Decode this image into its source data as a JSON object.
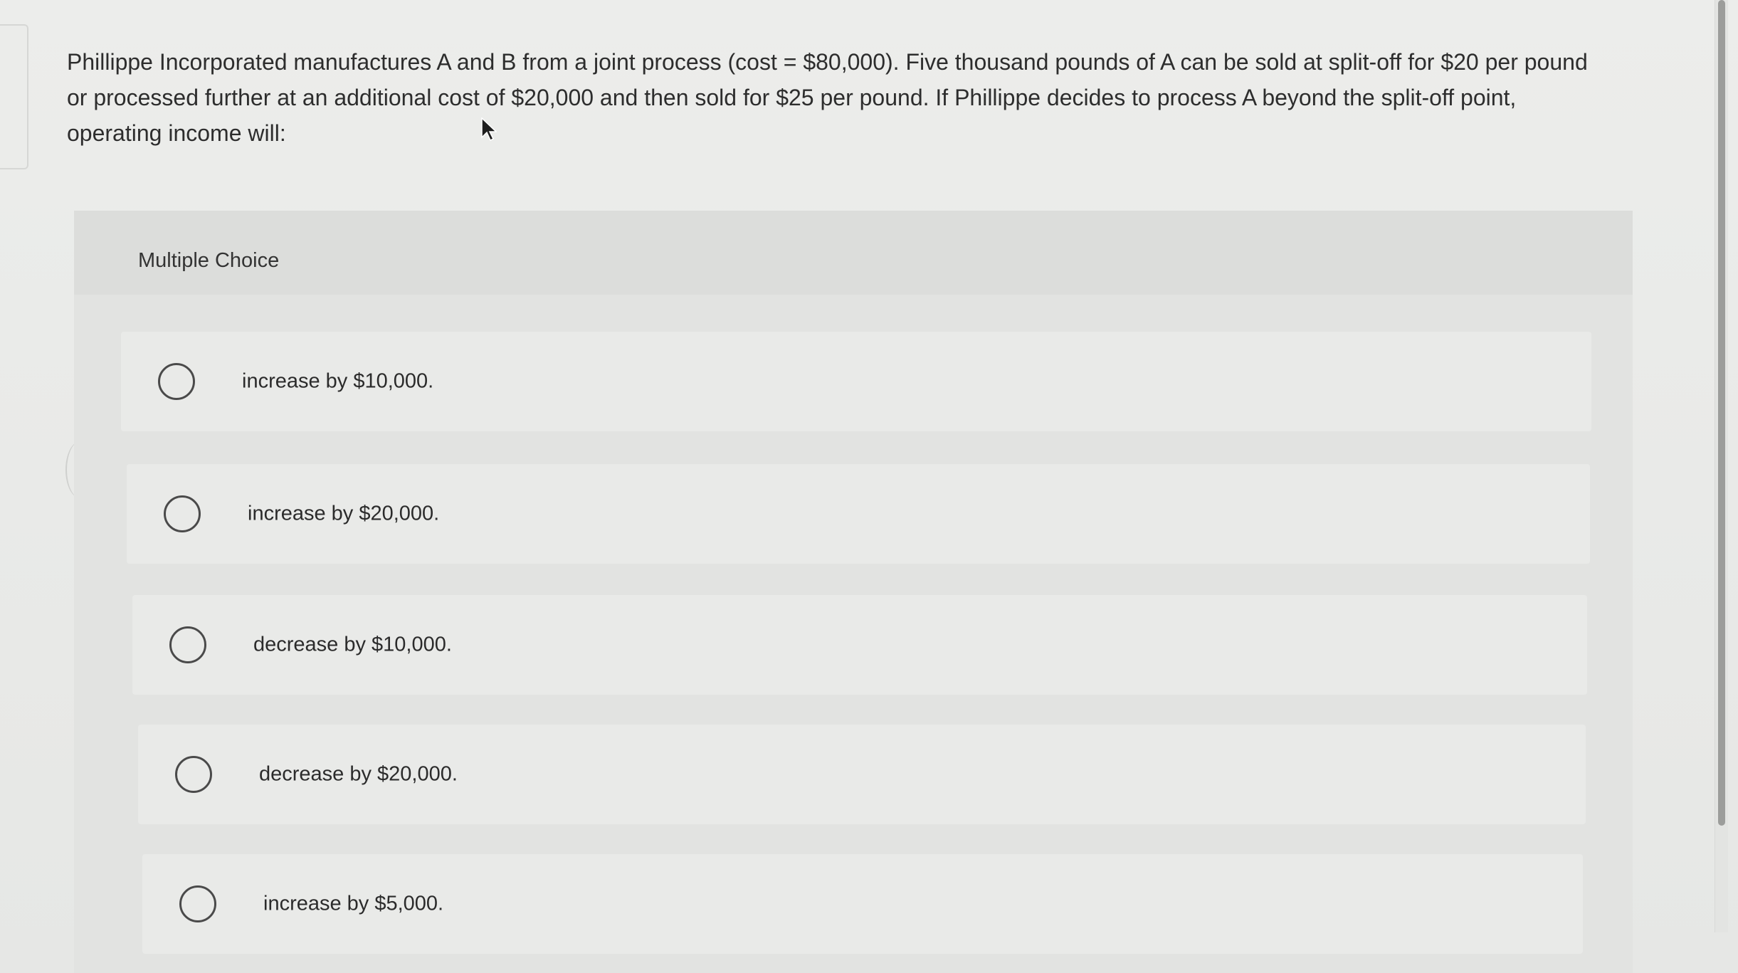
{
  "question": {
    "text": "Phillippe Incorporated manufactures A and B from a joint process (cost = $80,000). Five thousand pounds of A can be sold at split-off for $20 per pound or processed further at an additional cost of $20,000 and then sold for $25 per pound. If Phillippe decides to process A beyond the split-off point, operating income will:"
  },
  "multiple_choice": {
    "label": "Multiple Choice",
    "options": [
      {
        "label": "increase by $10,000."
      },
      {
        "label": "increase by $20,000."
      },
      {
        "label": "decrease by $10,000."
      },
      {
        "label": "decrease by $20,000."
      },
      {
        "label": "increase by $5,000."
      }
    ]
  },
  "icons": {
    "cursor": "mouse-pointer-icon",
    "radio": "radio-unselected-icon"
  },
  "colors": {
    "background": "#e9eae8",
    "panel": "#e2e3e1",
    "option_bg": "#e9eae8",
    "text": "#2b2b2b"
  }
}
